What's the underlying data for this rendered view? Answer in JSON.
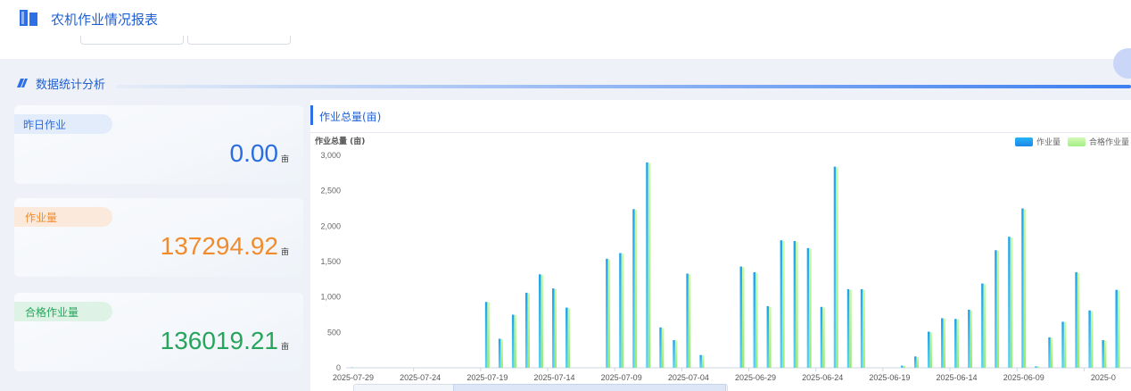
{
  "header": {
    "app_title": "农机作业情况报表",
    "logo_icon": "book-logo-icon"
  },
  "section": {
    "title": "数据统计分析",
    "icon": "slash-icon"
  },
  "stats": [
    {
      "label": "昨日作业",
      "value": "0.00",
      "unit": "亩",
      "color": "#2b6de0",
      "pill_bg": "#e3ecfb"
    },
    {
      "label": "作业量",
      "value": "137294.92",
      "unit": "亩",
      "color": "#f08c2e",
      "pill_bg": "#fbe9dc"
    },
    {
      "label": "合格作业量",
      "value": "136019.21",
      "unit": "亩",
      "color": "#27a55c",
      "pill_bg": "#def3e6"
    }
  ],
  "chart_panel": {
    "title": "作业总量(亩)"
  },
  "chart_data": {
    "type": "bar",
    "ylabel": "作业总量 (亩)",
    "ylim": [
      0,
      3000
    ],
    "yticks": [
      "0",
      "500",
      "1,000",
      "1,500",
      "2,000",
      "2,500",
      "3,000"
    ],
    "xtick_labels": [
      "2025-07-29",
      "2025-07-24",
      "2025-07-19",
      "2025-07-14",
      "2025-07-09",
      "2025-07-04",
      "2025-06-29",
      "2025-06-24",
      "2025-06-19",
      "2025-06-14",
      "2025-06-09",
      "2025-0"
    ],
    "legend": [
      {
        "name": "作业量",
        "color": "#1fa3ee"
      },
      {
        "name": "合格作业量",
        "color": "#b6f59a"
      }
    ],
    "series": [
      {
        "name": "作业量",
        "values": [
          5,
          0,
          0,
          0,
          0,
          0,
          0,
          0,
          0,
          0,
          930,
          410,
          750,
          1060,
          1320,
          1120,
          850,
          0,
          0,
          1540,
          1620,
          2240,
          2900,
          570,
          390,
          1330,
          180,
          0,
          0,
          1430,
          1350,
          870,
          1800,
          1790,
          1690,
          860,
          2840,
          1110,
          1110,
          0,
          0,
          30,
          160,
          510,
          700,
          690,
          820,
          1190,
          1660,
          1850,
          2250,
          20,
          430,
          650,
          1350,
          810,
          390,
          1100
        ]
      },
      {
        "name": "合格作业量",
        "values": [
          5,
          0,
          0,
          0,
          0,
          0,
          0,
          0,
          0,
          0,
          925,
          405,
          745,
          1050,
          1310,
          1110,
          840,
          0,
          0,
          1530,
          1610,
          2230,
          2890,
          560,
          385,
          1320,
          175,
          0,
          0,
          1420,
          1340,
          860,
          1790,
          1780,
          1680,
          850,
          2830,
          1100,
          1100,
          0,
          0,
          28,
          155,
          500,
          695,
          685,
          810,
          1180,
          1650,
          1840,
          2240,
          18,
          425,
          645,
          1340,
          800,
          385,
          1090
        ]
      }
    ]
  }
}
